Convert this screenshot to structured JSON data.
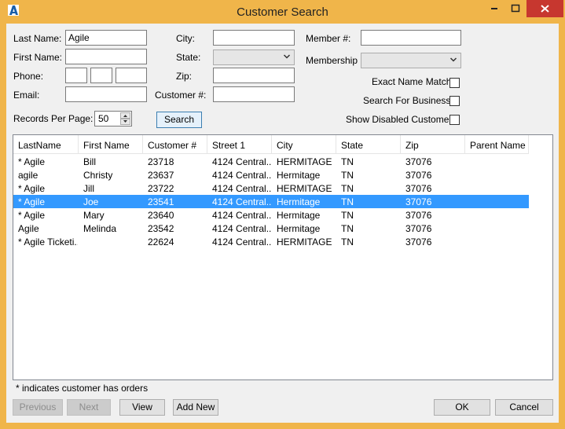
{
  "window": {
    "title": "Customer Search"
  },
  "form": {
    "last_name_label": "Last Name:",
    "last_name_value": "Agile",
    "first_name_label": "First Name:",
    "first_name_value": "",
    "phone_label": "Phone:",
    "email_label": "Email:",
    "email_value": "",
    "city_label": "City:",
    "city_value": "",
    "state_label": "State:",
    "state_value": "",
    "zip_label": "Zip:",
    "zip_value": "",
    "customer_no_label": "Customer #:",
    "customer_no_value": "",
    "member_no_label": "Member #:",
    "member_no_value": "",
    "membership_label": "Membership",
    "membership_value": "",
    "exact_name_match_label": "Exact Name Match",
    "search_for_business_label": "Search For Business",
    "show_disabled_label": "Show Disabled Customer",
    "records_per_page_label": "Records Per Page:",
    "records_per_page_value": "50",
    "search_button": "Search"
  },
  "grid": {
    "columns": [
      "LastName",
      "First Name",
      "Customer #",
      "Street 1",
      "City",
      "State",
      "Zip",
      "Parent Name"
    ],
    "rows": [
      {
        "last": "* Agile",
        "first": "Bill",
        "cust": "23718",
        "street": "4124 Central...",
        "city": "HERMITAGE",
        "state": "TN",
        "zip": "37076",
        "parent": ""
      },
      {
        "last": "agile",
        "first": "Christy",
        "cust": "23637",
        "street": "4124 Central...",
        "city": "Hermitage",
        "state": "TN",
        "zip": "37076",
        "parent": ""
      },
      {
        "last": "* Agile",
        "first": "Jill",
        "cust": "23722",
        "street": "4124 Central...",
        "city": "HERMITAGE",
        "state": "TN",
        "zip": "37076",
        "parent": ""
      },
      {
        "last": "* Agile",
        "first": "Joe",
        "cust": "23541",
        "street": "4124 Central...",
        "city": "Hermitage",
        "state": "TN",
        "zip": "37076",
        "parent": ""
      },
      {
        "last": "* Agile",
        "first": "Mary",
        "cust": "23640",
        "street": "4124 Central...",
        "city": "Hermitage",
        "state": "TN",
        "zip": "37076",
        "parent": ""
      },
      {
        "last": "Agile",
        "first": "Melinda",
        "cust": "23542",
        "street": "4124 Central...",
        "city": "Hermitage",
        "state": "TN",
        "zip": "37076",
        "parent": ""
      },
      {
        "last": "* Agile Ticketi...",
        "first": "",
        "cust": "22624",
        "street": "4124 Central...",
        "city": "HERMITAGE",
        "state": "TN",
        "zip": "37076",
        "parent": ""
      }
    ],
    "selected_row": 3
  },
  "footer": {
    "note": "* indicates customer has orders",
    "previous_button": "Previous",
    "next_button": "Next",
    "view_button": "View",
    "add_new_button": "Add New",
    "ok_button": "OK",
    "cancel_button": "Cancel"
  },
  "colors": {
    "title_bar": "#f0b54a",
    "close_button": "#c7372f",
    "selection": "#3399ff"
  },
  "icons": {
    "app": "agile-logo-icon",
    "minimize": "minimize-icon",
    "maximize": "maximize-icon",
    "close": "close-icon"
  }
}
